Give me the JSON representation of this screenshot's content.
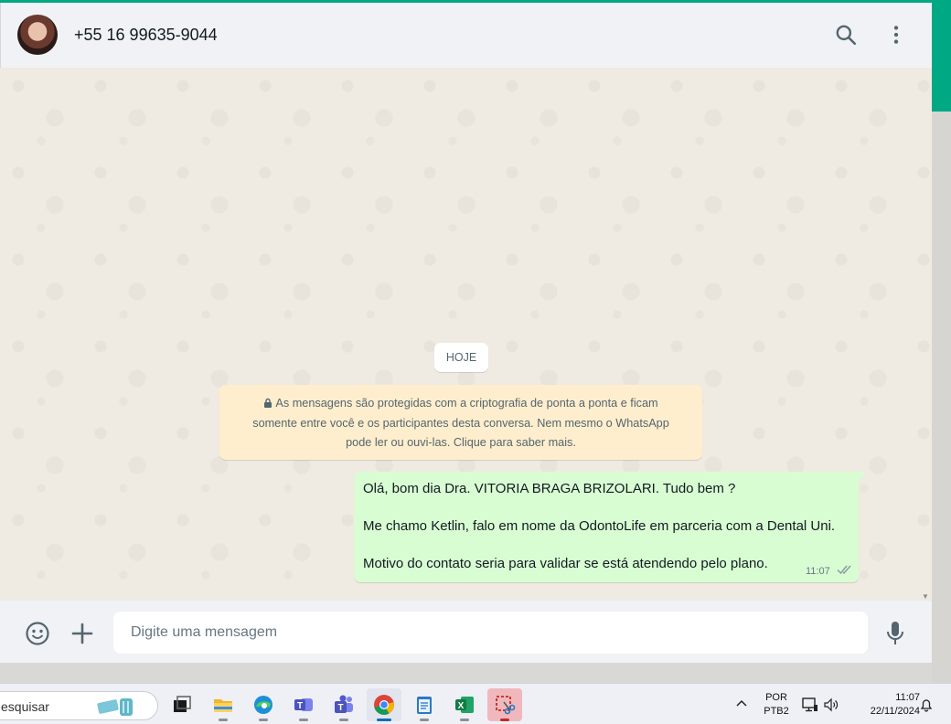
{
  "header": {
    "contact_name": "+55 16 99635-9044",
    "icons": [
      "search-icon",
      "menu-icon"
    ]
  },
  "chat": {
    "date_separator": "HOJE",
    "encryption_notice": {
      "line1": "As mensagens são protegidas com a criptografia de ponta a ponta e ficam",
      "line2": "somente entre você e os participantes desta conversa. Nem mesmo o WhatsApp",
      "line3": "pode ler ou ouvi-las. Clique para saber mais."
    },
    "messages": [
      {
        "direction": "outgoing",
        "lines": [
          "Olá, bom dia Dra. VITORIA BRAGA BRIZOLARI. Tudo bem ?",
          "Me chamo Ketlin, falo em nome da OdontoLife em parceria com a Dental Uni.",
          "Motivo do contato seria para validar se está atendendo pelo plano."
        ],
        "time": "11:07",
        "status": "read"
      }
    ]
  },
  "composer": {
    "placeholder": "Digite uma mensagem",
    "value": ""
  },
  "taskbar": {
    "search_text": "esquisar",
    "apps": [
      "task-view",
      "file-explorer",
      "edge",
      "teams",
      "teams-classic",
      "chrome",
      "notepad",
      "excel",
      "snipping-tool"
    ],
    "active_app": "chrome",
    "language_line1": "POR",
    "language_line2": "PTB2",
    "time": "11:07",
    "date": "22/11/2024"
  },
  "colors": {
    "accent": "#00a884",
    "outgoing_bubble": "#d9fdd3",
    "notice_bg": "#ffeecd",
    "chat_bg": "#efeae2",
    "panel_bg": "#f0f2f5"
  }
}
